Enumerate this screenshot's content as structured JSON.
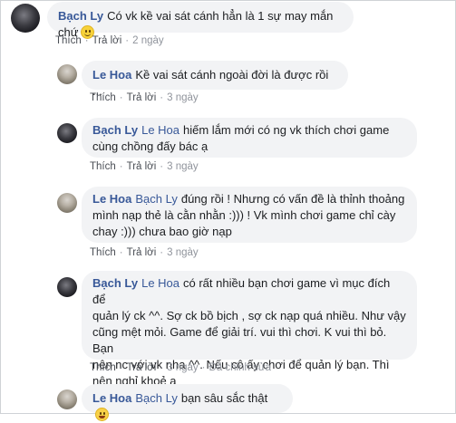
{
  "comments": [
    {
      "author": "Bạch Ly",
      "tag": "",
      "text": "Có vk kề vai sát cánh hẳn là 1 sự may mắn chứ",
      "emoji": "slightly-smiling-face-icon",
      "actions": {
        "like": "Thích",
        "reply": "Trả lời",
        "time": "2 ngày"
      }
    },
    {
      "author": "Le Hoa",
      "tag": "",
      "text": "Kề vai sát cánh ngoài đời là được rồi ...",
      "actions": {
        "like": "Thích",
        "reply": "Trả lời",
        "time": "3 ngày"
      }
    },
    {
      "author": "Bạch Ly",
      "tag": "Le Hoa",
      "text_lines": [
        "hiếm lắm mới có ng vk thích chơi game",
        "cùng chồng đấy bác ạ"
      ],
      "actions": {
        "like": "Thích",
        "reply": "Trả lời",
        "time": "3 ngày"
      }
    },
    {
      "author": "Le Hoa",
      "tag": "Bạch Ly",
      "text_lines": [
        "đúng rồi ! Nhưng có vấn đề là thỉnh thoảng",
        "mình nạp thẻ là cằn nhằn :))) ! Vk mình chơi game chỉ cày",
        "chay :))) chưa bao giờ nạp"
      ],
      "actions": {
        "like": "Thích",
        "reply": "Trả lời",
        "time": "3 ngày"
      }
    },
    {
      "author": "Bạch Ly",
      "tag": "Le Hoa",
      "text_lines": [
        "có rất nhiều bạn chơi game vì mục đích để",
        "quản lý ck ^^. Sợ ck bồ bịch , sợ ck nạp quá nhiều. Như vậy",
        "cũng mệt mỏi. Game để giải trí. vui thì chơi. K vui thì bỏ. Bạn",
        "nên nc với vk nha ^^. Nếu cô ấy chơi để quản lý bạn. Thì",
        "nên nghỉ khoẻ ạ"
      ],
      "actions": {
        "like": "Thích",
        "reply": "Trả lời",
        "time": "3 ngày",
        "edited": "Đã chỉnh sửa"
      }
    },
    {
      "author": "Le Hoa",
      "tag": "Bạch Ly",
      "text": "bạn sâu sắc thật",
      "emoji": "grinning-face-icon"
    }
  ]
}
